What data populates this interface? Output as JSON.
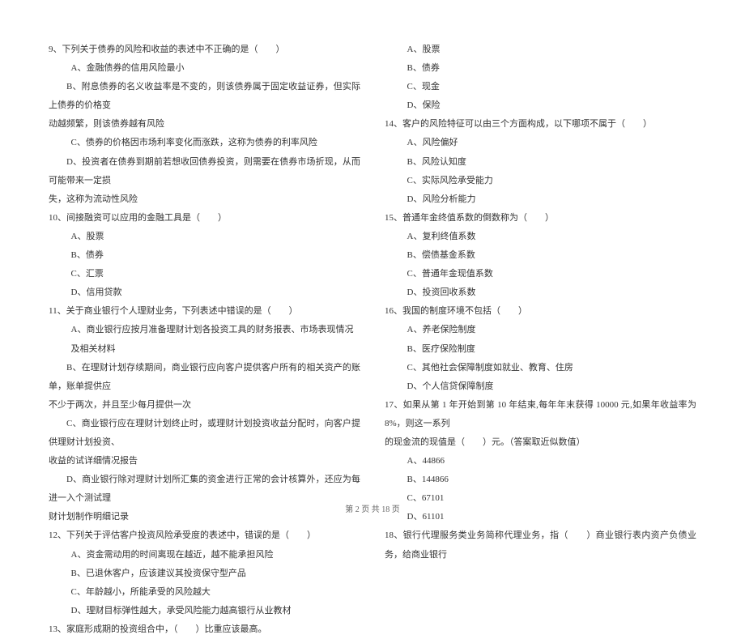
{
  "left_column": {
    "q9": {
      "text": "9、下列关于债券的风险和收益的表述中不正确的是（　　）",
      "optA": "A、金融债券的信用风险最小",
      "optB": "B、附息债券的名义收益率是不变的，则该债券属于固定收益证券，但实际上债券的价格变",
      "optB_cont": "动越频繁，则该债券越有风险",
      "optC": "C、债券的价格因市场利率变化而涨跌，这称为债券的利率风险",
      "optD": "D、投资者在债券到期前若想收回债券投资，则需要在债券市场折现，从而可能带来一定损",
      "optD_cont": "失，这称为流动性风险"
    },
    "q10": {
      "text": "10、间接融资可以应用的金融工具是（　　）",
      "optA": "A、股票",
      "optB": "B、债券",
      "optC": "C、汇票",
      "optD": "D、信用贷款"
    },
    "q11": {
      "text": "11、关于商业银行个人理财业务，下列表述中错误的是（　　）",
      "optA": "A、商业银行应按月准备理财计划各投资工具的财务报表、市场表现情况及相关材料",
      "optB": "B、在理财计划存续期间，商业银行应向客户提供客户所有的相关资产的账单，账单提供应",
      "optB_cont": "不少于两次，并且至少每月提供一次",
      "optC": "C、商业银行应在理财计划终止时，或理财计划投资收益分配时，向客户提供理财计划投资、",
      "optC_cont": "收益的试详细情况报告",
      "optD": "D、商业银行除对理财计划所汇集的资金进行正常的会计核算外，还应为每进一入个测试理",
      "optD_cont": "财计划制作明细记录"
    },
    "q12": {
      "text": "12、下列关于评估客户投资风险承受度的表述中，错误的是（　　）",
      "optA": "A、资金需动用的时间离现在越近，越不能承担风险",
      "optB": "B、已退休客户，应该建议其投资保守型产品",
      "optC": "C、年龄越小，所能承受的风险越大",
      "optD": "D、理财目标弹性越大，承受风险能力越高银行从业教材"
    },
    "q13": {
      "text": "13、家庭形成期的投资组合中，（　　）比重应该最高。"
    }
  },
  "right_column": {
    "q13_options": {
      "optA": "A、股票",
      "optB": "B、债券",
      "optC": "C、现金",
      "optD": "D、保险"
    },
    "q14": {
      "text": "14、客户的风险特征可以由三个方面构成，以下哪项不属于（　　）",
      "optA": "A、风险偏好",
      "optB": "B、风险认知度",
      "optC": "C、实际风险承受能力",
      "optD": "D、风险分析能力"
    },
    "q15": {
      "text": "15、普通年金终值系数的倒数称为（　　）",
      "optA": "A、复利终值系数",
      "optB": "B、偿债基金系数",
      "optC": "C、普通年金现值系数",
      "optD": "D、投资回收系数"
    },
    "q16": {
      "text": "16、我国的制度环境不包括（　　）",
      "optA": "A、养老保险制度",
      "optB": "B、医疗保险制度",
      "optC": "C、其他社会保障制度如就业、教育、住房",
      "optD": "D、个人信贷保障制度"
    },
    "q17": {
      "text": "17、如果从第 1 年开始到第 10 年结束,每年年末获得 10000 元,如果年收益率为 8%，则这一系列",
      "text_cont": "的现金流的现值是（　　）元。（答案取近似数值）",
      "optA": "A、44866",
      "optB": "B、144866",
      "optC": "C、67101",
      "optD": "D、61101"
    },
    "q18": {
      "text": "18、银行代理服务类业务简称代理业务，指（　　）商业银行表内资产负债业务，给商业银行"
    }
  },
  "footer": {
    "page_info": "第 2 页 共 18 页"
  }
}
